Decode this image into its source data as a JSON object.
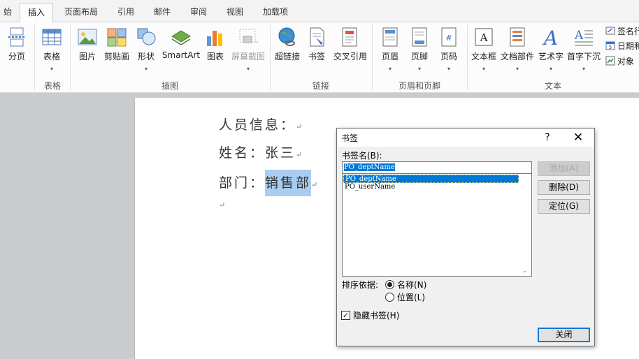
{
  "ribbon": {
    "tabs": [
      "始",
      "插入",
      "页面布局",
      "引用",
      "邮件",
      "审阅",
      "视图",
      "加载项"
    ],
    "active_tab": "插入",
    "buttons": {
      "page_break": "分页",
      "table": "表格",
      "picture": "图片",
      "clipart": "剪贴画",
      "shapes": "形状",
      "smartart": "SmartArt",
      "chart": "图表",
      "screenshot": "屏幕截图",
      "hyperlink": "超链接",
      "bookmark": "书签",
      "cross_reference": "交叉引用",
      "header": "页眉",
      "footer": "页脚",
      "page_number": "页码",
      "textbox": "文本框",
      "quick_parts": "文档部件",
      "wordart": "艺术字",
      "dropcap": "首字下沉",
      "signature_line": "签名行",
      "date_time": "日期和",
      "object": "对象"
    },
    "groups": {
      "tables": "表格",
      "illustrations": "插图",
      "links": "链接",
      "header_footer": "页眉和页脚",
      "text": "文本"
    },
    "dropdown_arrow": "▾"
  },
  "document": {
    "line1": "人员信息：",
    "line2": "姓名：张三",
    "line3_prefix": "部门：",
    "line3_selected": "销售部",
    "para_mark": "↵"
  },
  "dialog": {
    "title": "书签",
    "help": "?",
    "close": "✕",
    "name_label": "书签名(B):",
    "name_value": "PO_deptName",
    "bookmarks": [
      "PO_deptName",
      "PO_userName"
    ],
    "selected_bookmark": "PO_deptName",
    "buttons": {
      "add": "添加(A)",
      "delete": "删除(D)",
      "goto": "定位(G)",
      "close": "关闭"
    },
    "sort_label": "排序依据:",
    "sort_options": [
      "名称(N)",
      "位置(L)"
    ],
    "sort_selected": "名称(N)",
    "hidden_label": "隐藏书签(H)",
    "hidden_checked": true,
    "scroll_down": "⌄"
  }
}
